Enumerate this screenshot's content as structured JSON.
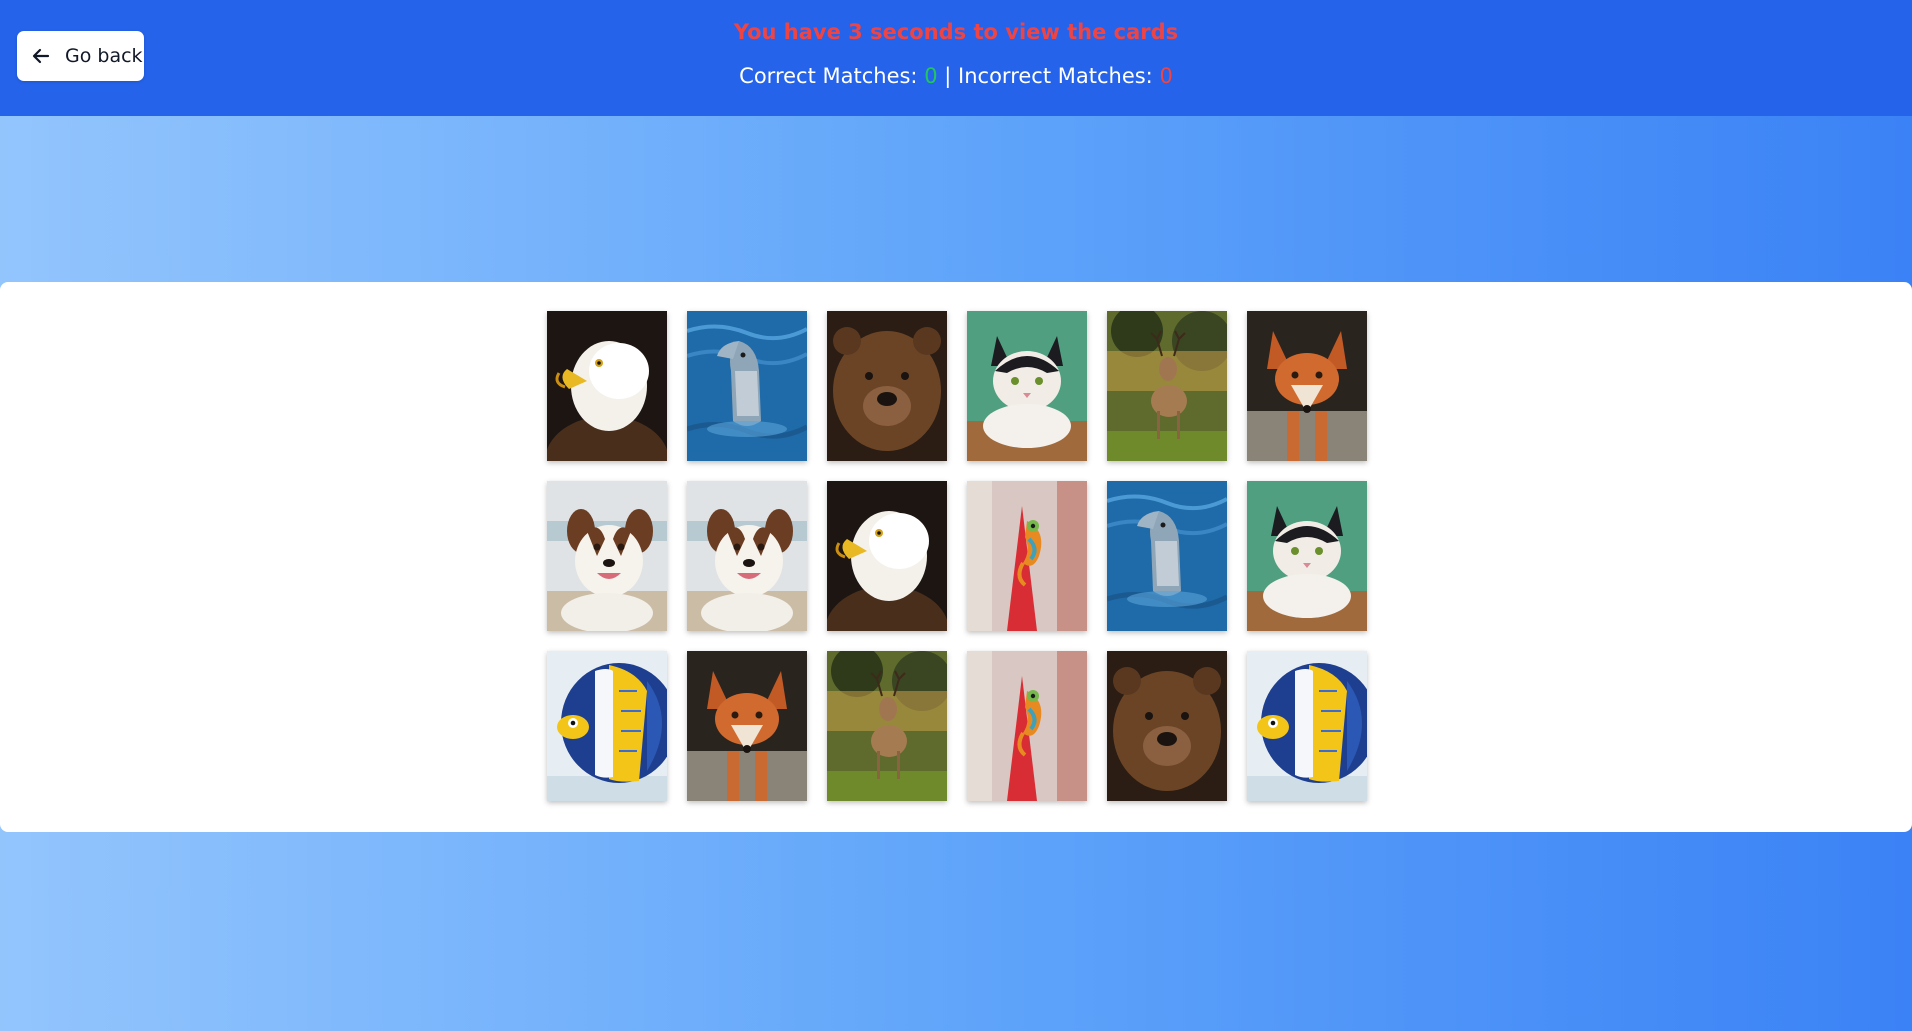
{
  "header": {
    "back_label": "Go back",
    "timer_text": "You have 3 seconds to view the cards",
    "correct_label": "Correct Matches:",
    "correct_value": "0",
    "separator": "|",
    "incorrect_label": "Incorrect Matches:",
    "incorrect_value": "0"
  },
  "colors": {
    "header_bg": "#2563eb",
    "timer": "#ef4444",
    "correct": "#22c55e",
    "incorrect": "#ef4444"
  },
  "cards": [
    {
      "animal": "eagle"
    },
    {
      "animal": "dolphin"
    },
    {
      "animal": "bear"
    },
    {
      "animal": "cat"
    },
    {
      "animal": "deer"
    },
    {
      "animal": "fox"
    },
    {
      "animal": "dog"
    },
    {
      "animal": "dog"
    },
    {
      "animal": "eagle"
    },
    {
      "animal": "chameleon"
    },
    {
      "animal": "dolphin"
    },
    {
      "animal": "cat"
    },
    {
      "animal": "fish"
    },
    {
      "animal": "fox"
    },
    {
      "animal": "deer"
    },
    {
      "animal": "chameleon"
    },
    {
      "animal": "bear"
    },
    {
      "animal": "fish"
    }
  ]
}
